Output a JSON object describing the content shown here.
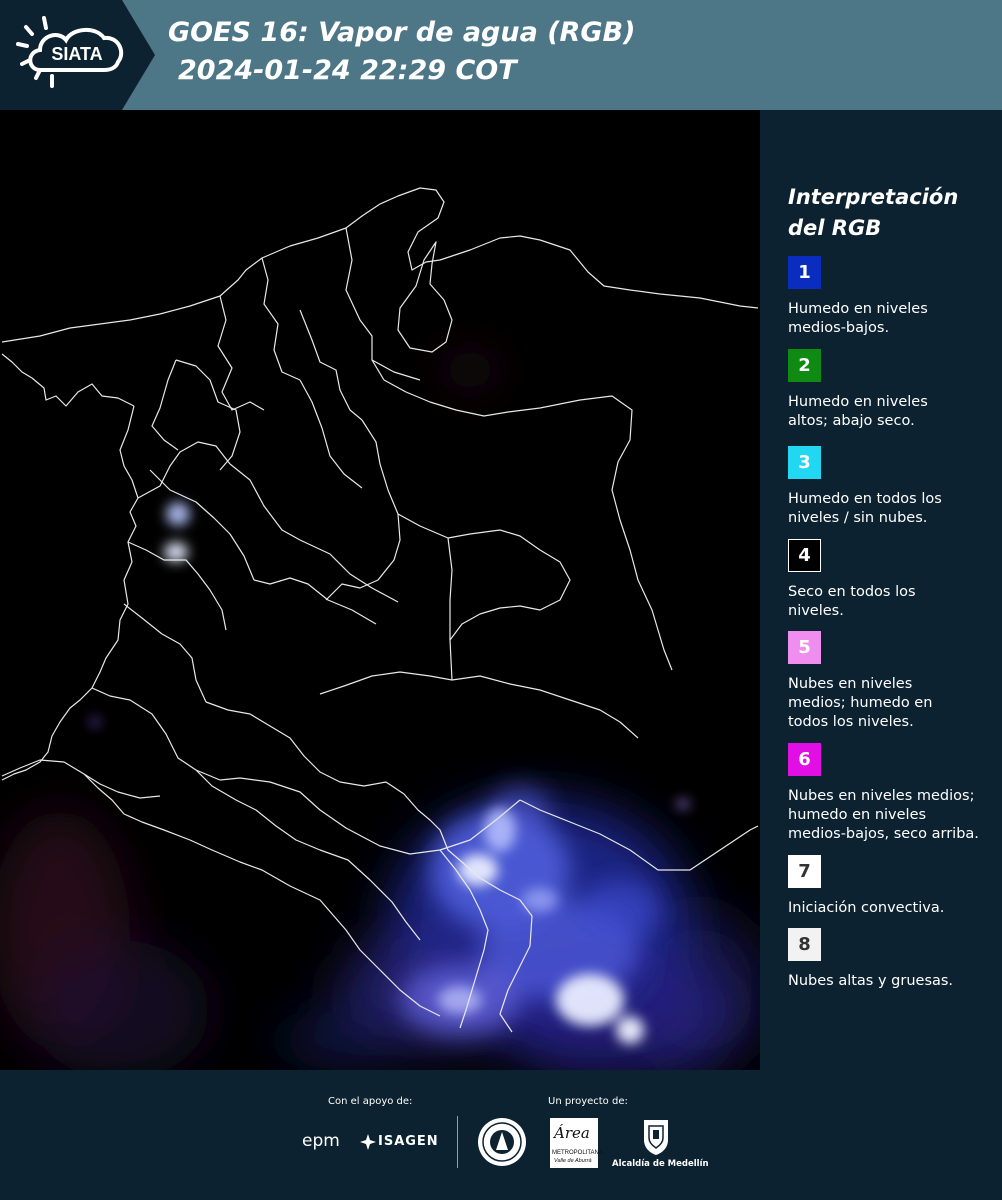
{
  "header": {
    "logo_text": "SIATA",
    "title_line1": "GOES 16: Vapor de agua (RGB)",
    "title_line2": "2024-01-24 22:29 COT"
  },
  "legend": {
    "title_line1": "Interpretación",
    "title_line2": "del RGB",
    "items": [
      {
        "number": "1",
        "color": "#0a2dbf",
        "number_color": "#ffffff",
        "description": "Humedo en niveles\nmedios-bajos."
      },
      {
        "number": "2",
        "color": "#0f8a12",
        "number_color": "#ffffff",
        "description": "Humedo en niveles\naltos; abajo seco."
      },
      {
        "number": "3",
        "color": "#22d7f2",
        "number_color": "#ffffff",
        "description": "Humedo en todos los\nniveles / sin nubes."
      },
      {
        "number": "4",
        "color": "#000000",
        "number_color": "#ffffff",
        "description": "Seco en todos los\nniveles."
      },
      {
        "number": "5",
        "color": "#f08ef0",
        "number_color": "#ffffff",
        "description": "Nubes en niveles\nmedios; humedo en\ntodos los niveles."
      },
      {
        "number": "6",
        "color": "#e10fe4",
        "number_color": "#ffffff",
        "description": "Nubes en niveles medios;\nhumedo en niveles\nmedios-bajos, seco arriba."
      },
      {
        "number": "7",
        "color": "#ffffff",
        "number_color": "#333333",
        "description": "Iniciación convectiva."
      },
      {
        "number": "8",
        "color": "#f2f2f2",
        "number_color": "#333333",
        "description": "Nubes altas y gruesas."
      }
    ]
  },
  "footer": {
    "support_caption": "Con el apoyo de:",
    "project_caption": "Un proyecto de:",
    "sponsors": {
      "epm": "epm",
      "isagen": "ISAGEN",
      "area_metropolitana": "Área",
      "area_sub": "METROPOLITANA",
      "area_sub2": "Valle de Aburrá",
      "alcaldia": "Alcaldía de Medellín"
    }
  }
}
